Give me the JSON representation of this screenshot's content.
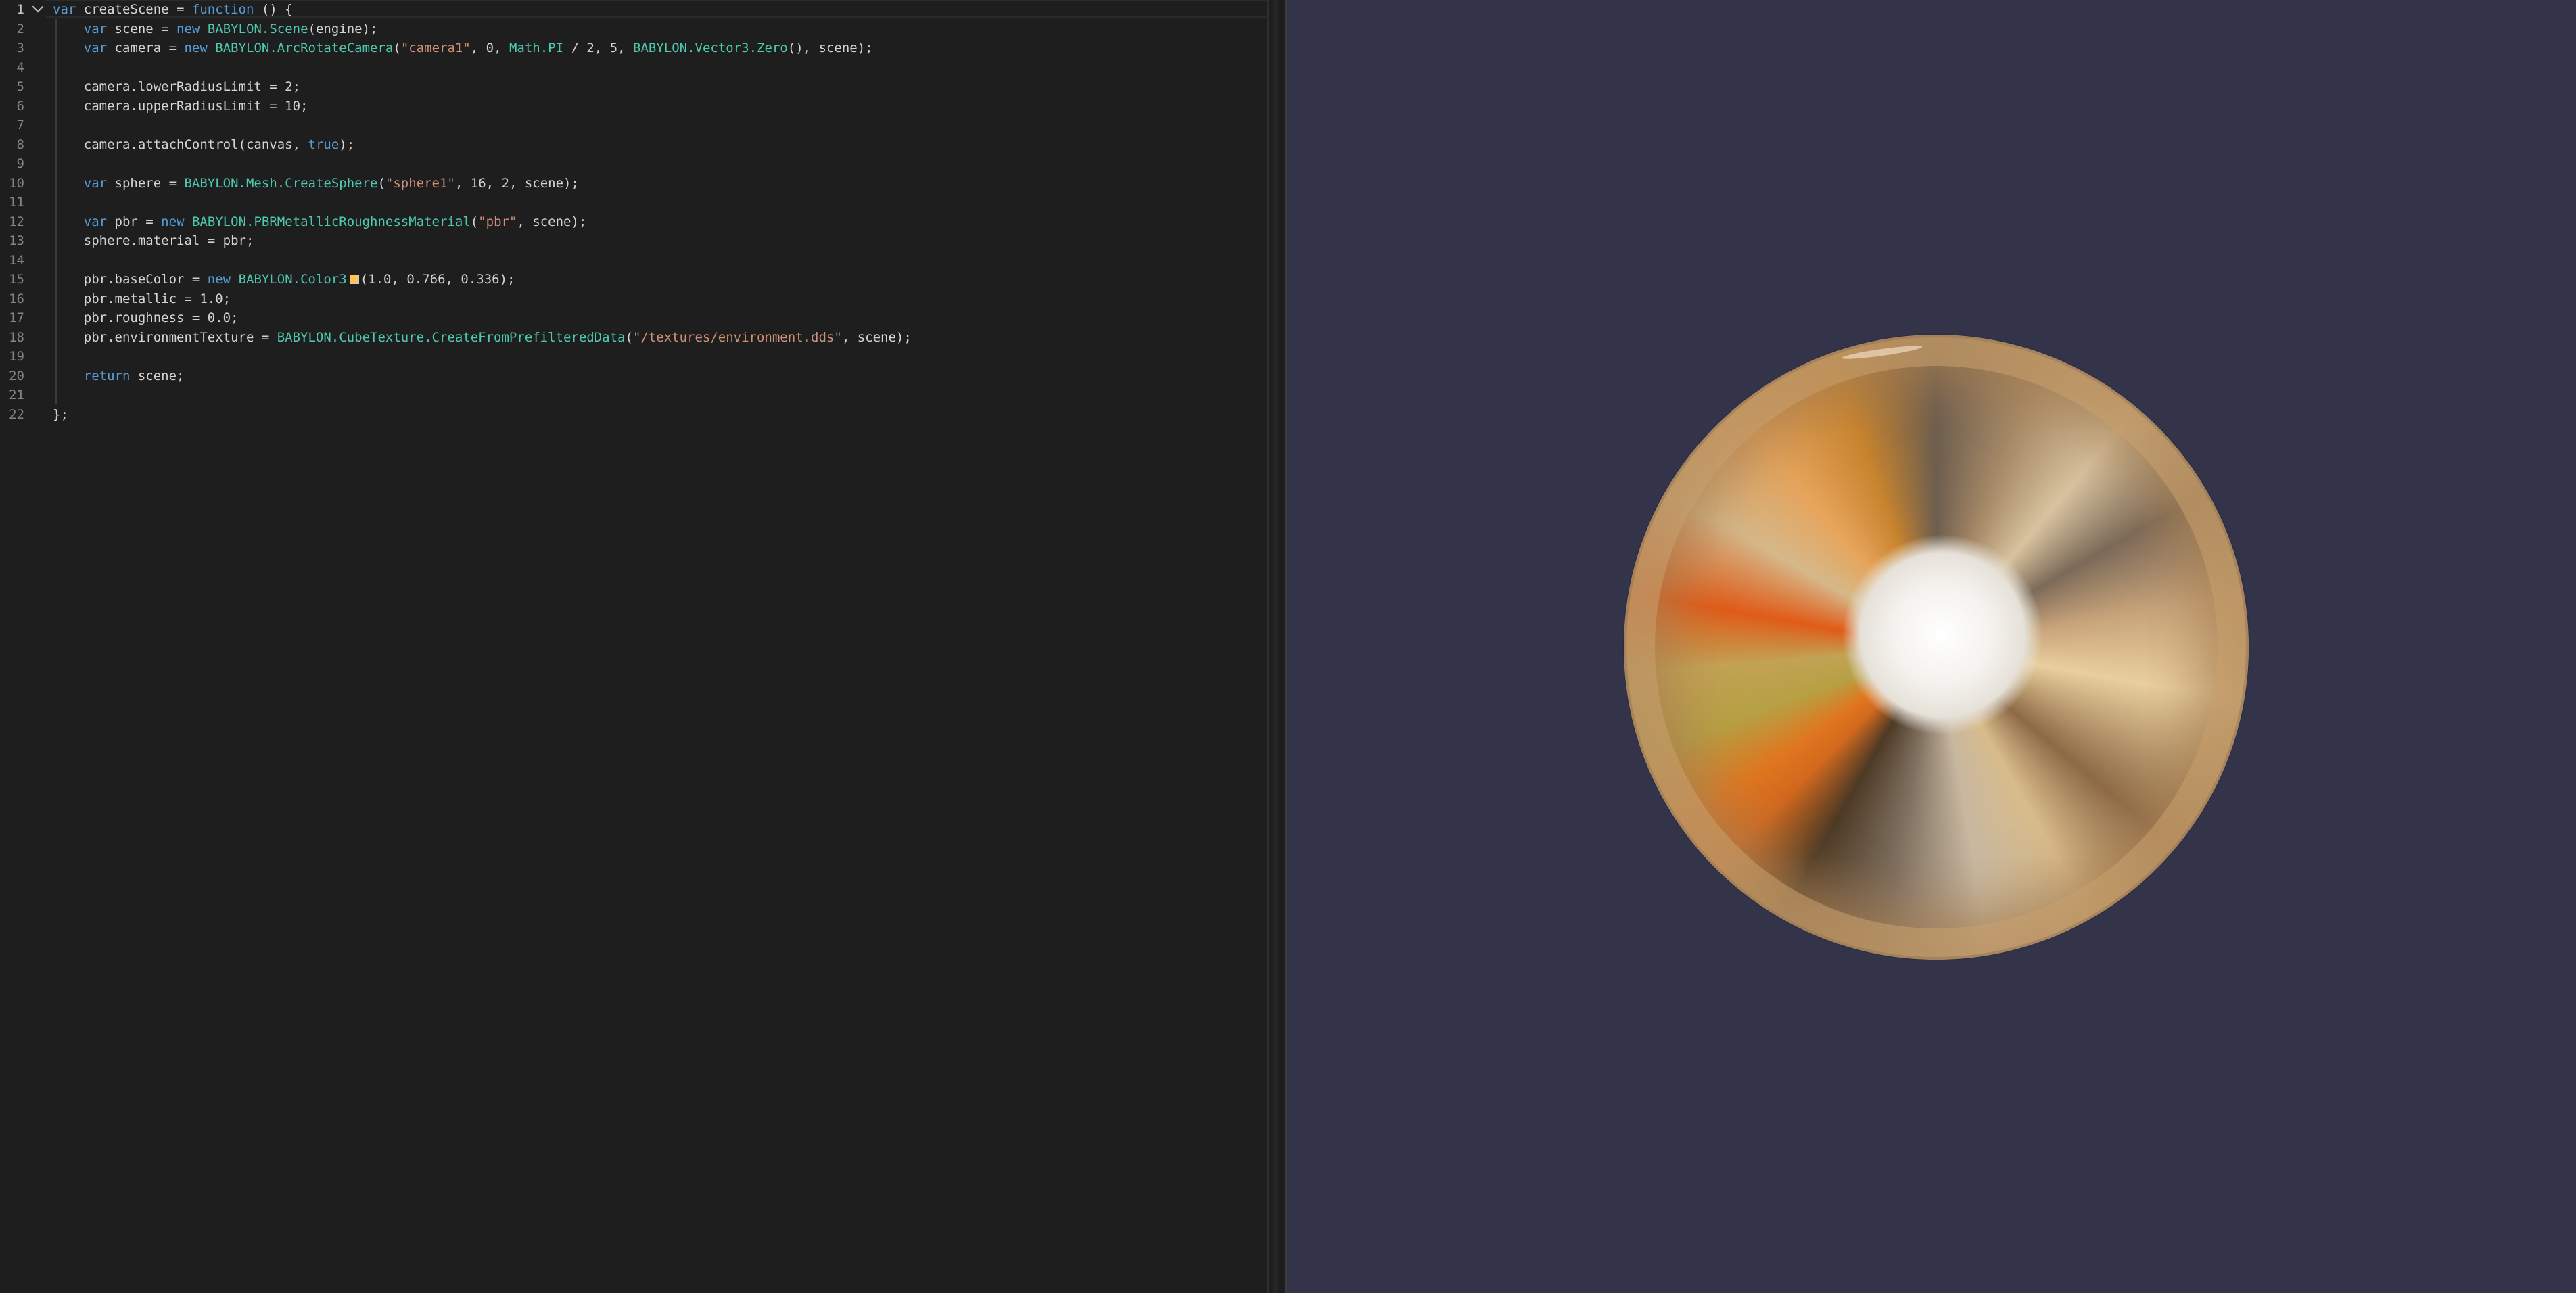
{
  "editor": {
    "lines": [
      {
        "number": "1",
        "tokens": [
          {
            "t": "var",
            "c": "kw"
          },
          {
            "t": " createScene = "
          },
          {
            "t": "function",
            "c": "kw"
          },
          {
            "t": " () {"
          }
        ]
      },
      {
        "number": "2",
        "tokens": [
          {
            "t": "    "
          },
          {
            "t": "var",
            "c": "kw"
          },
          {
            "t": " scene = "
          },
          {
            "t": "new",
            "c": "kw"
          },
          {
            "t": " "
          },
          {
            "t": "BABYLON.Scene",
            "c": "cls"
          },
          {
            "t": "(engine);"
          }
        ]
      },
      {
        "number": "3",
        "tokens": [
          {
            "t": "    "
          },
          {
            "t": "var",
            "c": "kw"
          },
          {
            "t": " camera = "
          },
          {
            "t": "new",
            "c": "kw"
          },
          {
            "t": " "
          },
          {
            "t": "BABYLON.ArcRotateCamera",
            "c": "cls"
          },
          {
            "t": "("
          },
          {
            "t": "\"camera1\"",
            "c": "str"
          },
          {
            "t": ", 0, "
          },
          {
            "t": "Math.PI",
            "c": "cls"
          },
          {
            "t": " / 2, 5, "
          },
          {
            "t": "BABYLON.Vector3.Zero",
            "c": "cls"
          },
          {
            "t": "(), scene);"
          }
        ]
      },
      {
        "number": "4",
        "tokens": []
      },
      {
        "number": "5",
        "tokens": [
          {
            "t": "    camera.lowerRadiusLimit = 2;"
          }
        ]
      },
      {
        "number": "6",
        "tokens": [
          {
            "t": "    camera.upperRadiusLimit = 10;"
          }
        ]
      },
      {
        "number": "7",
        "tokens": []
      },
      {
        "number": "8",
        "tokens": [
          {
            "t": "    camera.attachControl(canvas, "
          },
          {
            "t": "true",
            "c": "kw"
          },
          {
            "t": ");"
          }
        ]
      },
      {
        "number": "9",
        "tokens": []
      },
      {
        "number": "10",
        "tokens": [
          {
            "t": "    "
          },
          {
            "t": "var",
            "c": "kw"
          },
          {
            "t": " sphere = "
          },
          {
            "t": "BABYLON.Mesh.CreateSphere",
            "c": "cls"
          },
          {
            "t": "("
          },
          {
            "t": "\"sphere1\"",
            "c": "str"
          },
          {
            "t": ", 16, 2, scene);"
          }
        ]
      },
      {
        "number": "11",
        "tokens": []
      },
      {
        "number": "12",
        "tokens": [
          {
            "t": "    "
          },
          {
            "t": "var",
            "c": "kw"
          },
          {
            "t": " pbr = "
          },
          {
            "t": "new",
            "c": "kw"
          },
          {
            "t": " "
          },
          {
            "t": "BABYLON.PBRMetallicRoughnessMaterial",
            "c": "cls"
          },
          {
            "t": "("
          },
          {
            "t": "\"pbr\"",
            "c": "str"
          },
          {
            "t": ", scene);"
          }
        ]
      },
      {
        "number": "13",
        "tokens": [
          {
            "t": "    sphere.material = pbr;"
          }
        ]
      },
      {
        "number": "14",
        "tokens": []
      },
      {
        "number": "15",
        "tokens": [
          {
            "t": "    pbr.baseColor = "
          },
          {
            "t": "new",
            "c": "kw"
          },
          {
            "t": " "
          },
          {
            "t": "BABYLON.Color3",
            "c": "cls"
          },
          {
            "swatch": "#ffc356"
          },
          {
            "t": "(1.0, 0.766, 0.336);"
          }
        ]
      },
      {
        "number": "16",
        "tokens": [
          {
            "t": "    pbr.metallic = 1.0;"
          }
        ]
      },
      {
        "number": "17",
        "tokens": [
          {
            "t": "    pbr.roughness = 0.0;"
          }
        ]
      },
      {
        "number": "18",
        "tokens": [
          {
            "t": "    pbr.environmentTexture = "
          },
          {
            "t": "BABYLON.CubeTexture.CreateFromPrefilteredData",
            "c": "cls"
          },
          {
            "t": "("
          },
          {
            "t": "\"/textures/environment.dds\"",
            "c": "str"
          },
          {
            "t": ", scene);"
          }
        ]
      },
      {
        "number": "19",
        "tokens": []
      },
      {
        "number": "20",
        "tokens": [
          {
            "t": "    "
          },
          {
            "t": "return",
            "c": "kw"
          },
          {
            "t": " scene;"
          }
        ]
      },
      {
        "number": "21",
        "tokens": []
      },
      {
        "number": "22",
        "tokens": [
          {
            "t": "};"
          }
        ]
      }
    ],
    "active_line": "1"
  },
  "colors": {
    "editor_bg": "#1e1e1e",
    "viewport_bg": "#333449",
    "keyword": "#569cd6",
    "class": "#4ec9b0",
    "string": "#ce9178",
    "base_color_swatch": "#ffc356"
  },
  "viewport": {
    "object": "sphere1"
  }
}
